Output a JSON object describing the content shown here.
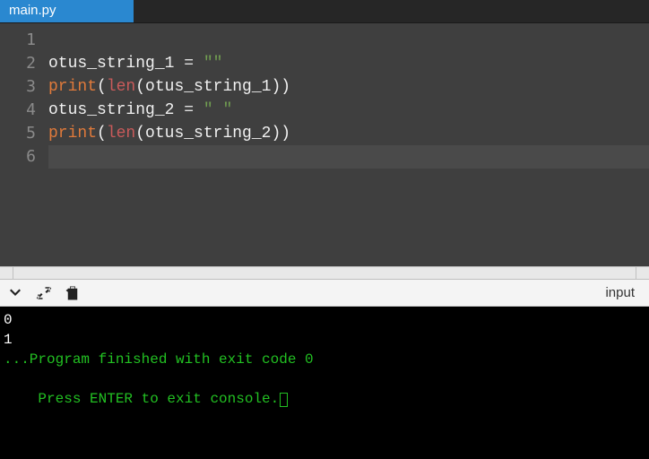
{
  "tab": {
    "title": "main.py"
  },
  "editor": {
    "lines": [
      {
        "n": "1",
        "tokens": []
      },
      {
        "n": "2",
        "tokens": [
          {
            "t": "otus_string_1",
            "c": "tok-id"
          },
          {
            "t": " ",
            "c": ""
          },
          {
            "t": "=",
            "c": "tok-op"
          },
          {
            "t": " ",
            "c": ""
          },
          {
            "t": "\"\"",
            "c": "tok-str"
          }
        ]
      },
      {
        "n": "3",
        "tokens": [
          {
            "t": "print",
            "c": "tok-fn"
          },
          {
            "t": "(",
            "c": "tok-pn"
          },
          {
            "t": "len",
            "c": "tok-bi"
          },
          {
            "t": "(otus_string_1))",
            "c": "tok-pn"
          }
        ]
      },
      {
        "n": "4",
        "tokens": [
          {
            "t": "otus_string_2",
            "c": "tok-id"
          },
          {
            "t": " ",
            "c": ""
          },
          {
            "t": "=",
            "c": "tok-op"
          },
          {
            "t": " ",
            "c": ""
          },
          {
            "t": "\" \"",
            "c": "tok-str"
          }
        ]
      },
      {
        "n": "5",
        "tokens": [
          {
            "t": "print",
            "c": "tok-fn"
          },
          {
            "t": "(",
            "c": "tok-pn"
          },
          {
            "t": "len",
            "c": "tok-bi"
          },
          {
            "t": "(otus_string_2))",
            "c": "tok-pn"
          }
        ]
      },
      {
        "n": "6",
        "tokens": [],
        "active": true
      }
    ]
  },
  "toolbar": {
    "input_label": "input"
  },
  "console": {
    "out1": "0",
    "out2": "1",
    "blank": "",
    "msg1": "...Program finished with exit code 0",
    "msg2": "Press ENTER to exit console."
  }
}
